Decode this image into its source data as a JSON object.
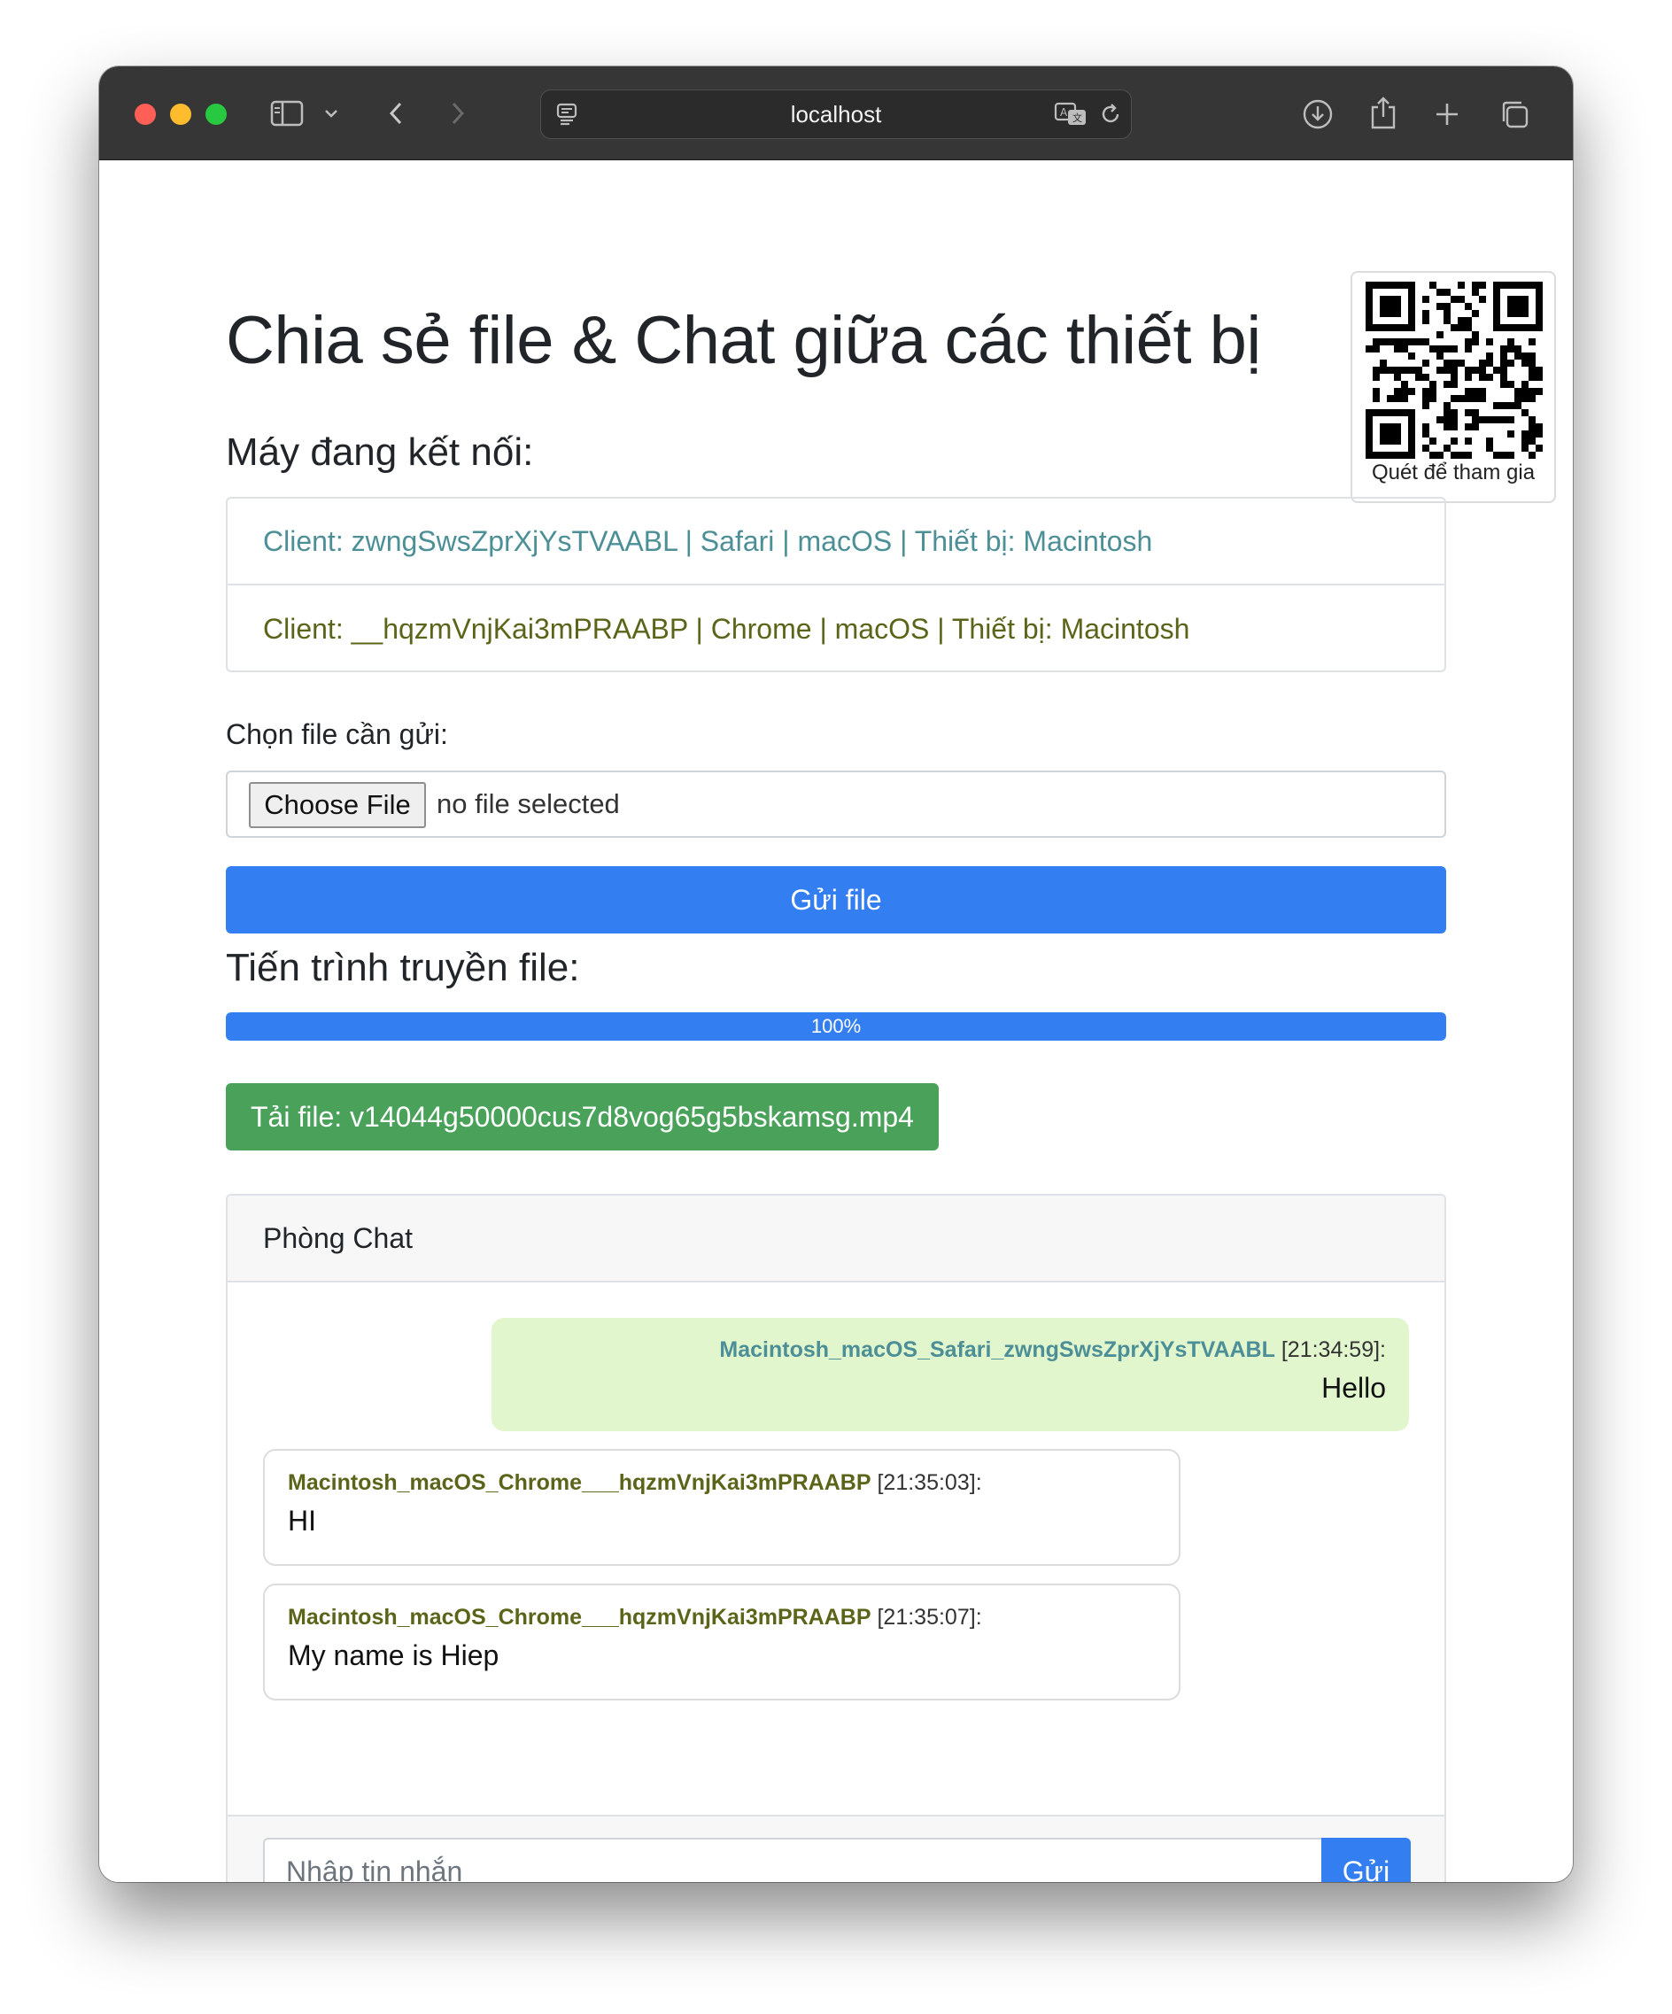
{
  "browser": {
    "address": "localhost"
  },
  "qr": {
    "caption": "Quét để tham gia"
  },
  "page": {
    "title": "Chia sẻ file & Chat giữa các thiết bị",
    "clients_heading": "Máy đang kết nối:",
    "clients": [
      {
        "label": "Client: zwngSwsZprXjYsTVAABL | Safari | macOS | Thiết bị: Macintosh",
        "color": "#4c8f97"
      },
      {
        "label": "Client: __hqzmVnjKai3mPRAABP | Chrome | macOS | Thiết bị: Macintosh",
        "color": "#5c6419"
      }
    ],
    "file_label": "Chọn file cần gửi:",
    "choose_file": "Choose File",
    "no_file": "no file selected",
    "send_file": "Gửi file",
    "progress_heading": "Tiến trình truyền file:",
    "progress_value": 100,
    "progress_label": "100%",
    "download_label": "Tải file: v14044g50000cus7d8vog65g5bskamsg.mp4"
  },
  "chat": {
    "header": "Phòng Chat",
    "messages": [
      {
        "sender": "Macintosh_macOS_Safari_zwngSwsZprXjYsTVAABL",
        "time": "[21:34:59]:",
        "text": "Hello",
        "sender_color": "#4c8f97"
      },
      {
        "sender": "Macintosh_macOS_Chrome___hqzmVnjKai3mPRAABP",
        "time": "[21:35:03]:",
        "text": "HI",
        "sender_color": "#5c6419"
      },
      {
        "sender": "Macintosh_macOS_Chrome___hqzmVnjKai3mPRAABP",
        "time": "[21:35:07]:",
        "text": "My name is Hiep",
        "sender_color": "#5c6419"
      }
    ],
    "input_placeholder": "Nhập tin nhắn",
    "send_label": "Gửi"
  },
  "colors": {
    "primary": "#337ef0",
    "success": "#4aa25a",
    "mine_bubble": "#e1f6cd"
  }
}
